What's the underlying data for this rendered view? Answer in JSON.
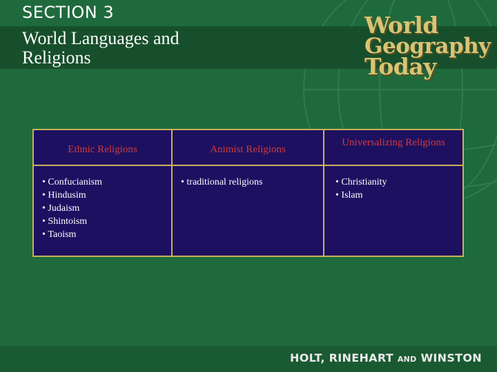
{
  "header": {
    "section": "SECTION 3",
    "title": "World Languages and Religions"
  },
  "logo": {
    "line1": "World",
    "line2": "Geography",
    "line3": "Today"
  },
  "table": {
    "columns": [
      {
        "heading": "Ethnic Religions",
        "items": [
          "Confucianism",
          "Hindusim",
          "Judaism",
          "Shintoism",
          "Taoism"
        ]
      },
      {
        "heading": "Animist Religions",
        "items": [
          "traditional religions"
        ]
      },
      {
        "heading": "Universalizing Religions",
        "items": [
          "Christianity",
          "Islam"
        ]
      }
    ]
  },
  "footer": {
    "publisher_a": "HOLT, RINEHART ",
    "publisher_and": "AND",
    "publisher_b": " WINSTON"
  },
  "colors": {
    "background": "#1f6a3c",
    "table_fill": "#1e1060",
    "border": "#c9b25a",
    "heading_text": "#d23a3a"
  }
}
